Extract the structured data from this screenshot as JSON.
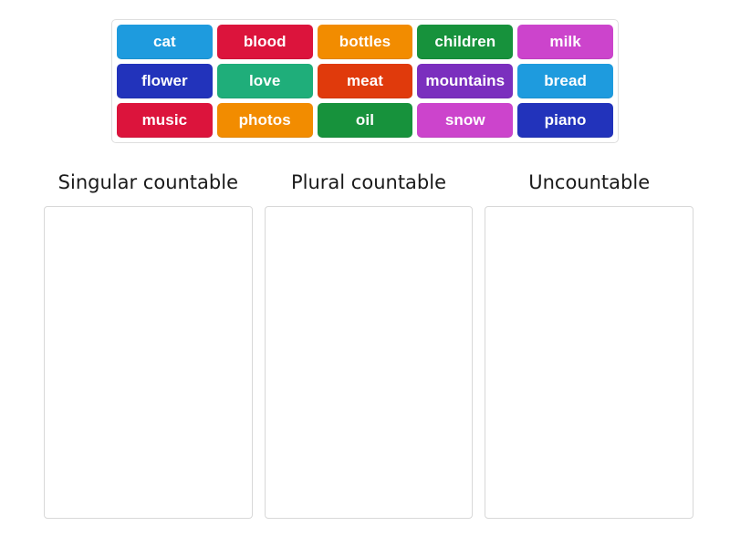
{
  "word_bank": {
    "name": "word-bank",
    "rows": [
      [
        {
          "label": "cat",
          "color": "#1E9BDE"
        },
        {
          "label": "blood",
          "color": "#DC143C"
        },
        {
          "label": "bottles",
          "color": "#F28C00"
        },
        {
          "label": "children",
          "color": "#17923C"
        },
        {
          "label": "milk",
          "color": "#CC44CC"
        }
      ],
      [
        {
          "label": "flower",
          "color": "#2233BB"
        },
        {
          "label": "love",
          "color": "#1FAE7A"
        },
        {
          "label": "meat",
          "color": "#E03A0C"
        },
        {
          "label": "mountains",
          "color": "#7B2FBE"
        },
        {
          "label": "bread",
          "color": "#1E9BDE"
        }
      ],
      [
        {
          "label": "music",
          "color": "#DC143C"
        },
        {
          "label": "photos",
          "color": "#F28C00"
        },
        {
          "label": "oil",
          "color": "#17923C"
        },
        {
          "label": "snow",
          "color": "#CC44CC"
        },
        {
          "label": "piano",
          "color": "#2233BB"
        }
      ]
    ]
  },
  "categories": [
    {
      "title": "Singular countable",
      "items": []
    },
    {
      "title": "Plural countable",
      "items": []
    },
    {
      "title": "Uncountable",
      "items": []
    }
  ]
}
